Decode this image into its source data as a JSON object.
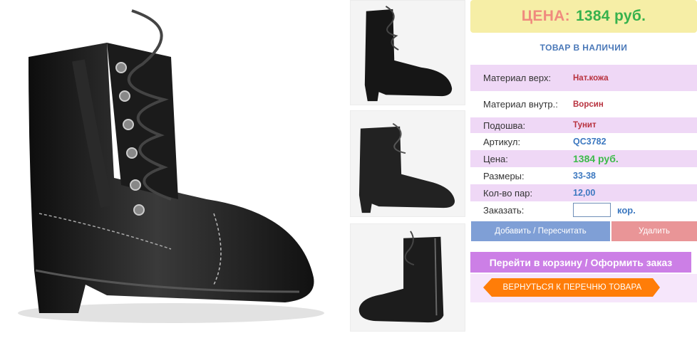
{
  "images": {
    "main": "boot-photo-main",
    "thumbs": [
      "boot-photo-side",
      "boot-photo-inner",
      "boot-photo-zipper"
    ]
  },
  "price_banner": {
    "label": "ЦЕНА:",
    "value": "1384 руб."
  },
  "stock_status": "ТОВАР В НАЛИЧИИ",
  "specs": [
    {
      "key": "Материал верх:",
      "value": "Нат.кожа"
    },
    {
      "key": "Материал внутр.:",
      "value": "Ворсин"
    },
    {
      "key": "Подошва:",
      "value": "Тунит"
    },
    {
      "key": "Артикул:",
      "value": "QC3782"
    },
    {
      "key": "Цена:",
      "value": "1384 руб."
    },
    {
      "key": "Размеры:",
      "value": "33-38"
    },
    {
      "key": "Кол-во пар:",
      "value": "12,00"
    }
  ],
  "order": {
    "label": "Заказать:",
    "value": "",
    "unit": "кор."
  },
  "buttons": {
    "add": "Добавить / Пересчитать",
    "delete": "Удалить",
    "cart": "Перейти в корзину / Оформить заказ",
    "back": "ВЕРНУТЬСЯ К ПЕРЕЧНЮ ТОВАРА"
  },
  "colors": {
    "price_label": "#f08a7e",
    "price_value": "#37b24d",
    "banner_bg": "#f6eea6",
    "row_shade": "#efd8f6",
    "add_button": "#7f9fd6",
    "delete_button": "#e99597",
    "cart_button": "#cc7fe6",
    "back_button": "#ff7d08"
  }
}
